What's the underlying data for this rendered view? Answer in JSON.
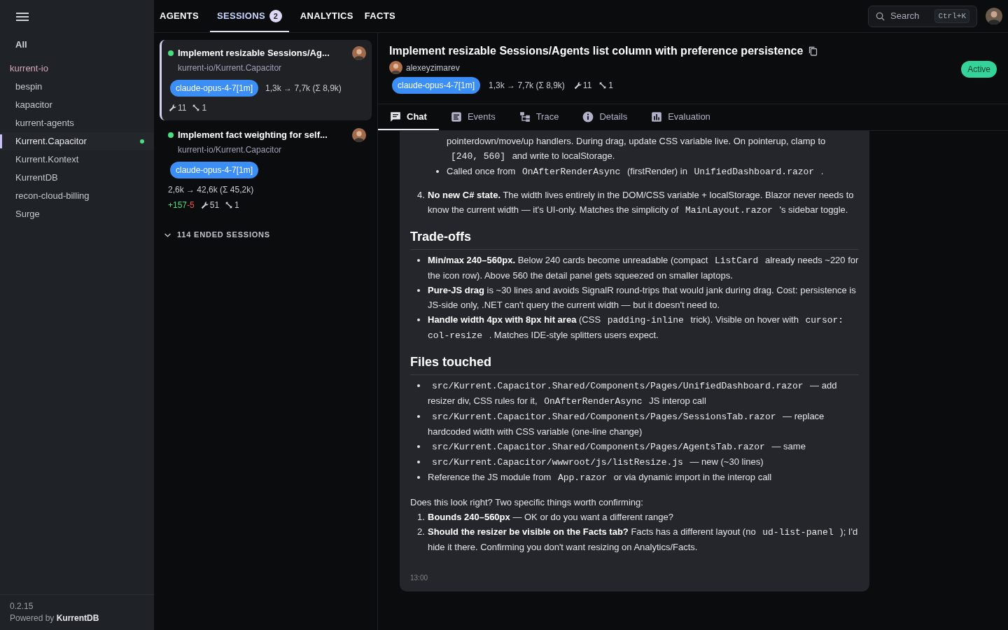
{
  "sidebar": {
    "all_label": "All",
    "groups": [
      {
        "name": "kurrent-io",
        "items": [
          {
            "label": "bespin",
            "selected": false,
            "active": false
          },
          {
            "label": "kapacitor",
            "selected": false,
            "active": false
          },
          {
            "label": "kurrent-agents",
            "selected": false,
            "active": false
          },
          {
            "label": "Kurrent.Capacitor",
            "selected": true,
            "active": true
          },
          {
            "label": "Kurrent.Kontext",
            "selected": false,
            "active": false
          },
          {
            "label": "KurrentDB",
            "selected": false,
            "active": false
          },
          {
            "label": "recon-cloud-billing",
            "selected": false,
            "active": false
          },
          {
            "label": "Surge",
            "selected": false,
            "active": false
          }
        ]
      }
    ],
    "version": "0.2.15",
    "powered_by": "Powered by **KurrentDB**"
  },
  "nav_tabs": [
    {
      "label": "AGENTS",
      "selected": false
    },
    {
      "label": "SESSIONS",
      "selected": true,
      "badge": "2"
    },
    {
      "label": "ANALYTICS",
      "selected": false
    },
    {
      "label": "FACTS",
      "selected": false
    }
  ],
  "search": {
    "placeholder": "Search",
    "shortcut": "Ctrl+K"
  },
  "sessions": [
    {
      "title": "Implement resizable Sessions/Ag...",
      "repo": "kurrent-io/Kurrent.Capacitor",
      "model": "claude-opus-4-7[1m]",
      "tokens": "1,3k → 7,7k (Σ 8,9k)",
      "tools": "11",
      "subagents": "1",
      "selected": true
    },
    {
      "title": "Implement fact weighting for self...",
      "repo": "kurrent-io/Kurrent.Capacitor",
      "model": "claude-opus-4-7[1m]",
      "tokens": "2,6k → 42,6k (Σ 45,2k)",
      "added": "+157",
      "removed": "-5",
      "tools": "51",
      "subagents": "1",
      "selected": false
    }
  ],
  "ended_sessions": {
    "label": "114 ENDED SESSIONS",
    "expanded": false
  },
  "detail": {
    "title": "Implement resizable Sessions/Agents list column with preference persistence",
    "author": "alexeyzimarev",
    "model": "claude-opus-4-7[1m]",
    "tokens": "1,3k → 7,7k (Σ 8,9k)",
    "tools": "11",
    "subagents": "1",
    "status": "Active",
    "tabs": [
      {
        "label": "Chat",
        "selected": true
      },
      {
        "label": "Events",
        "selected": false
      },
      {
        "label": "Trace",
        "selected": false
      },
      {
        "label": "Details",
        "selected": false
      },
      {
        "label": "Evaluation",
        "selected": false
      }
    ]
  },
  "message": {
    "blocks": [
      {
        "kind": "continuation",
        "parts": [
          {
            "kind": "text",
            "text": "pointerdown/move/up handlers. During drag, update CSS variable live. On pointerup, clamp to "
          },
          {
            "kind": "code",
            "text": "[240, 560]"
          },
          {
            "kind": "text",
            "text": " and write to localStorage."
          }
        ]
      },
      {
        "kind": "subbullet",
        "parts": [
          {
            "kind": "text",
            "text": "Called once from "
          },
          {
            "kind": "code",
            "text": "OnAfterRenderAsync"
          },
          {
            "kind": "text",
            "text": " (firstRender) in "
          },
          {
            "kind": "code",
            "text": "UnifiedDashboard.razor"
          },
          {
            "kind": "text",
            "text": " ."
          }
        ]
      },
      {
        "kind": "numbered",
        "marker": "4.",
        "parts": [
          {
            "kind": "bold",
            "text": "No new C# state."
          },
          {
            "kind": "text",
            "text": " The width lives entirely in the DOM/CSS variable + localStorage. Blazor never needs to know the current width — it's UI-only. Matches the simplicity of "
          },
          {
            "kind": "code",
            "text": "MainLayout.razor"
          },
          {
            "kind": "text",
            "text": " 's sidebar toggle."
          }
        ]
      },
      {
        "kind": "heading",
        "parts": [
          {
            "kind": "text",
            "text": "Trade-offs"
          }
        ]
      },
      {
        "kind": "bullet",
        "parts": [
          {
            "kind": "bold",
            "text": "Min/max 240–560px."
          },
          {
            "kind": "text",
            "text": " Below 240 cards become unreadable (compact "
          },
          {
            "kind": "code",
            "text": "ListCard"
          },
          {
            "kind": "text",
            "text": " already needs ~220 for the icon row). Above 560 the detail panel gets squeezed on smaller laptops."
          }
        ]
      },
      {
        "kind": "bullet",
        "parts": [
          {
            "kind": "bold",
            "text": "Pure-JS drag"
          },
          {
            "kind": "text",
            "text": " is ~30 lines and avoids SignalR round-trips that would jank during drag. Cost: persistence is JS-side only, .NET can't query the current width — but it doesn't need to."
          }
        ]
      },
      {
        "kind": "bullet",
        "parts": [
          {
            "kind": "bold",
            "text": "Handle width 4px with 8px hit area"
          },
          {
            "kind": "text",
            "text": " (CSS "
          },
          {
            "kind": "code",
            "text": "padding-inline"
          },
          {
            "kind": "text",
            "text": " trick). Visible on hover with "
          },
          {
            "kind": "code",
            "text": "cursor: col-resize"
          },
          {
            "kind": "text",
            "text": " . Matches IDE-style splitters users expect."
          }
        ]
      },
      {
        "kind": "heading",
        "parts": [
          {
            "kind": "text",
            "text": "Files touched"
          }
        ]
      },
      {
        "kind": "bullet",
        "parts": [
          {
            "kind": "code",
            "text": "src/Kurrent.Capacitor.Shared/Components/Pages/UnifiedDashboard.razor"
          },
          {
            "kind": "text",
            "text": " — add resizer div, CSS rules for it, "
          },
          {
            "kind": "code",
            "text": "OnAfterRenderAsync"
          },
          {
            "kind": "text",
            "text": " JS interop call"
          }
        ]
      },
      {
        "kind": "bullet",
        "parts": [
          {
            "kind": "code",
            "text": "src/Kurrent.Capacitor.Shared/Components/Pages/SessionsTab.razor"
          },
          {
            "kind": "text",
            "text": " — replace hardcoded width with CSS variable (one-line change)"
          }
        ]
      },
      {
        "kind": "bullet",
        "parts": [
          {
            "kind": "code",
            "text": "src/Kurrent.Capacitor.Shared/Components/Pages/AgentsTab.razor"
          },
          {
            "kind": "text",
            "text": " — same"
          }
        ]
      },
      {
        "kind": "bullet",
        "parts": [
          {
            "kind": "code",
            "text": "src/Kurrent.Capacitor/wwwroot/js/listResize.js"
          },
          {
            "kind": "text",
            "text": " — new (~30 lines)"
          }
        ]
      },
      {
        "kind": "bullet",
        "parts": [
          {
            "kind": "text",
            "text": "Reference the JS module from "
          },
          {
            "kind": "code",
            "text": "App.razor"
          },
          {
            "kind": "text",
            "text": " or via dynamic import in the interop call"
          }
        ]
      },
      {
        "kind": "paragraph",
        "parts": [
          {
            "kind": "text",
            "text": "Does this look right? Two specific things worth confirming:"
          }
        ]
      },
      {
        "kind": "numbered",
        "marker": "1.",
        "parts": [
          {
            "kind": "bold",
            "text": "Bounds 240–560px"
          },
          {
            "kind": "text",
            "text": " — OK or do you want a different range?"
          }
        ]
      },
      {
        "kind": "numbered",
        "marker": "2.",
        "parts": [
          {
            "kind": "bold",
            "text": "Should the resizer be visible on the Facts tab?"
          },
          {
            "kind": "text",
            "text": " Facts has a different layout (no "
          },
          {
            "kind": "code",
            "text": "ud-list-panel"
          },
          {
            "kind": "text",
            "text": " ); I'd hide it there. Confirming you don't want resizing on Analytics/Facts."
          }
        ]
      }
    ],
    "time": "13:00"
  }
}
